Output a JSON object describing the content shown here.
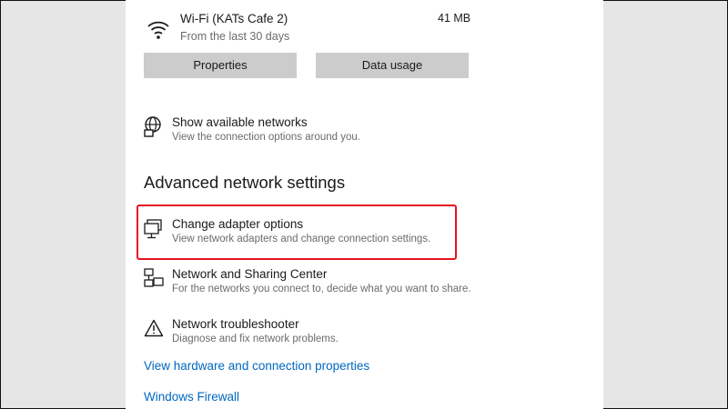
{
  "wifi": {
    "name": "Wi-Fi (KATs Cafe 2)",
    "period": "From the last 30 days",
    "usage": "41 MB",
    "icon": "wifi-signal-icon"
  },
  "buttons": {
    "properties": "Properties",
    "data_usage": "Data usage"
  },
  "show_networks": {
    "title": "Show available networks",
    "subtitle": "View the connection options around you.",
    "icon": "network-globe-icon"
  },
  "advanced": {
    "heading": "Advanced network settings",
    "items": [
      {
        "title": "Change adapter options",
        "subtitle": "View network adapters and change connection settings.",
        "icon": "monitor-adapter-icon"
      },
      {
        "title": "Network and Sharing Center",
        "subtitle": "For the networks you connect to, decide what you want to share.",
        "icon": "sharing-center-icon"
      },
      {
        "title": "Network troubleshooter",
        "subtitle": "Diagnose and fix network problems.",
        "icon": "warning-triangle-icon"
      }
    ]
  },
  "links": {
    "hardware": "View hardware and connection properties",
    "firewall": "Windows Firewall"
  },
  "colors": {
    "link": "#0067c0",
    "highlight": "#e81123",
    "button_bg": "#cccccc"
  }
}
